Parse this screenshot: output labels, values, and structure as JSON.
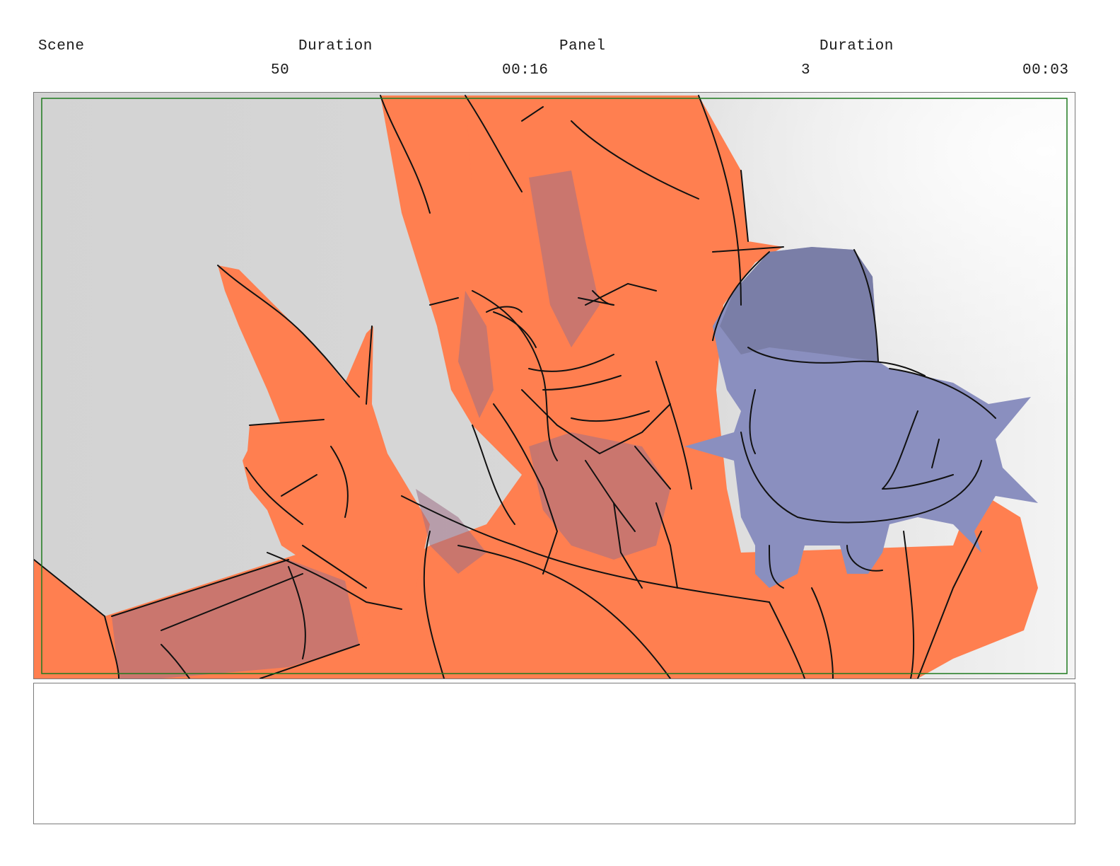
{
  "header": {
    "scene_label": "Scene",
    "duration_label": "Duration",
    "panel_label": "Panel",
    "panel_duration_label": "Duration",
    "scene_number": "50",
    "scene_duration": "00:16",
    "panel_number": "3",
    "panel_duration": "00:03"
  },
  "panel": {
    "safe_frame_color": "#1e7a1e",
    "character_color": "#ff7f50",
    "creature_color": "#8a8fbf",
    "background_color": "#d3d3d3"
  },
  "notes": {
    "text": ""
  }
}
